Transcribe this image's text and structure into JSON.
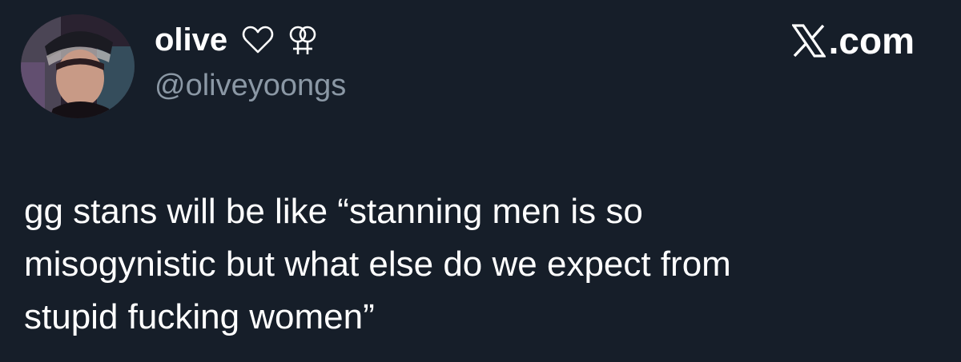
{
  "post": {
    "author": {
      "display_name": "olive",
      "name_icons": [
        "heart-outline-icon",
        "female-pair-icon"
      ],
      "handle": "@oliveyoongs",
      "avatar": "avatar-photo"
    },
    "brand": {
      "icon": "x-logo-icon",
      "label": ".com"
    },
    "text_lines": [
      "gg stans will be like “stanning men is so",
      "misogynistic but what else do we expect from",
      "stupid fucking women”"
    ]
  },
  "colors": {
    "background": "#161e29",
    "text": "#ffffff",
    "handle": "#8b98a5"
  }
}
